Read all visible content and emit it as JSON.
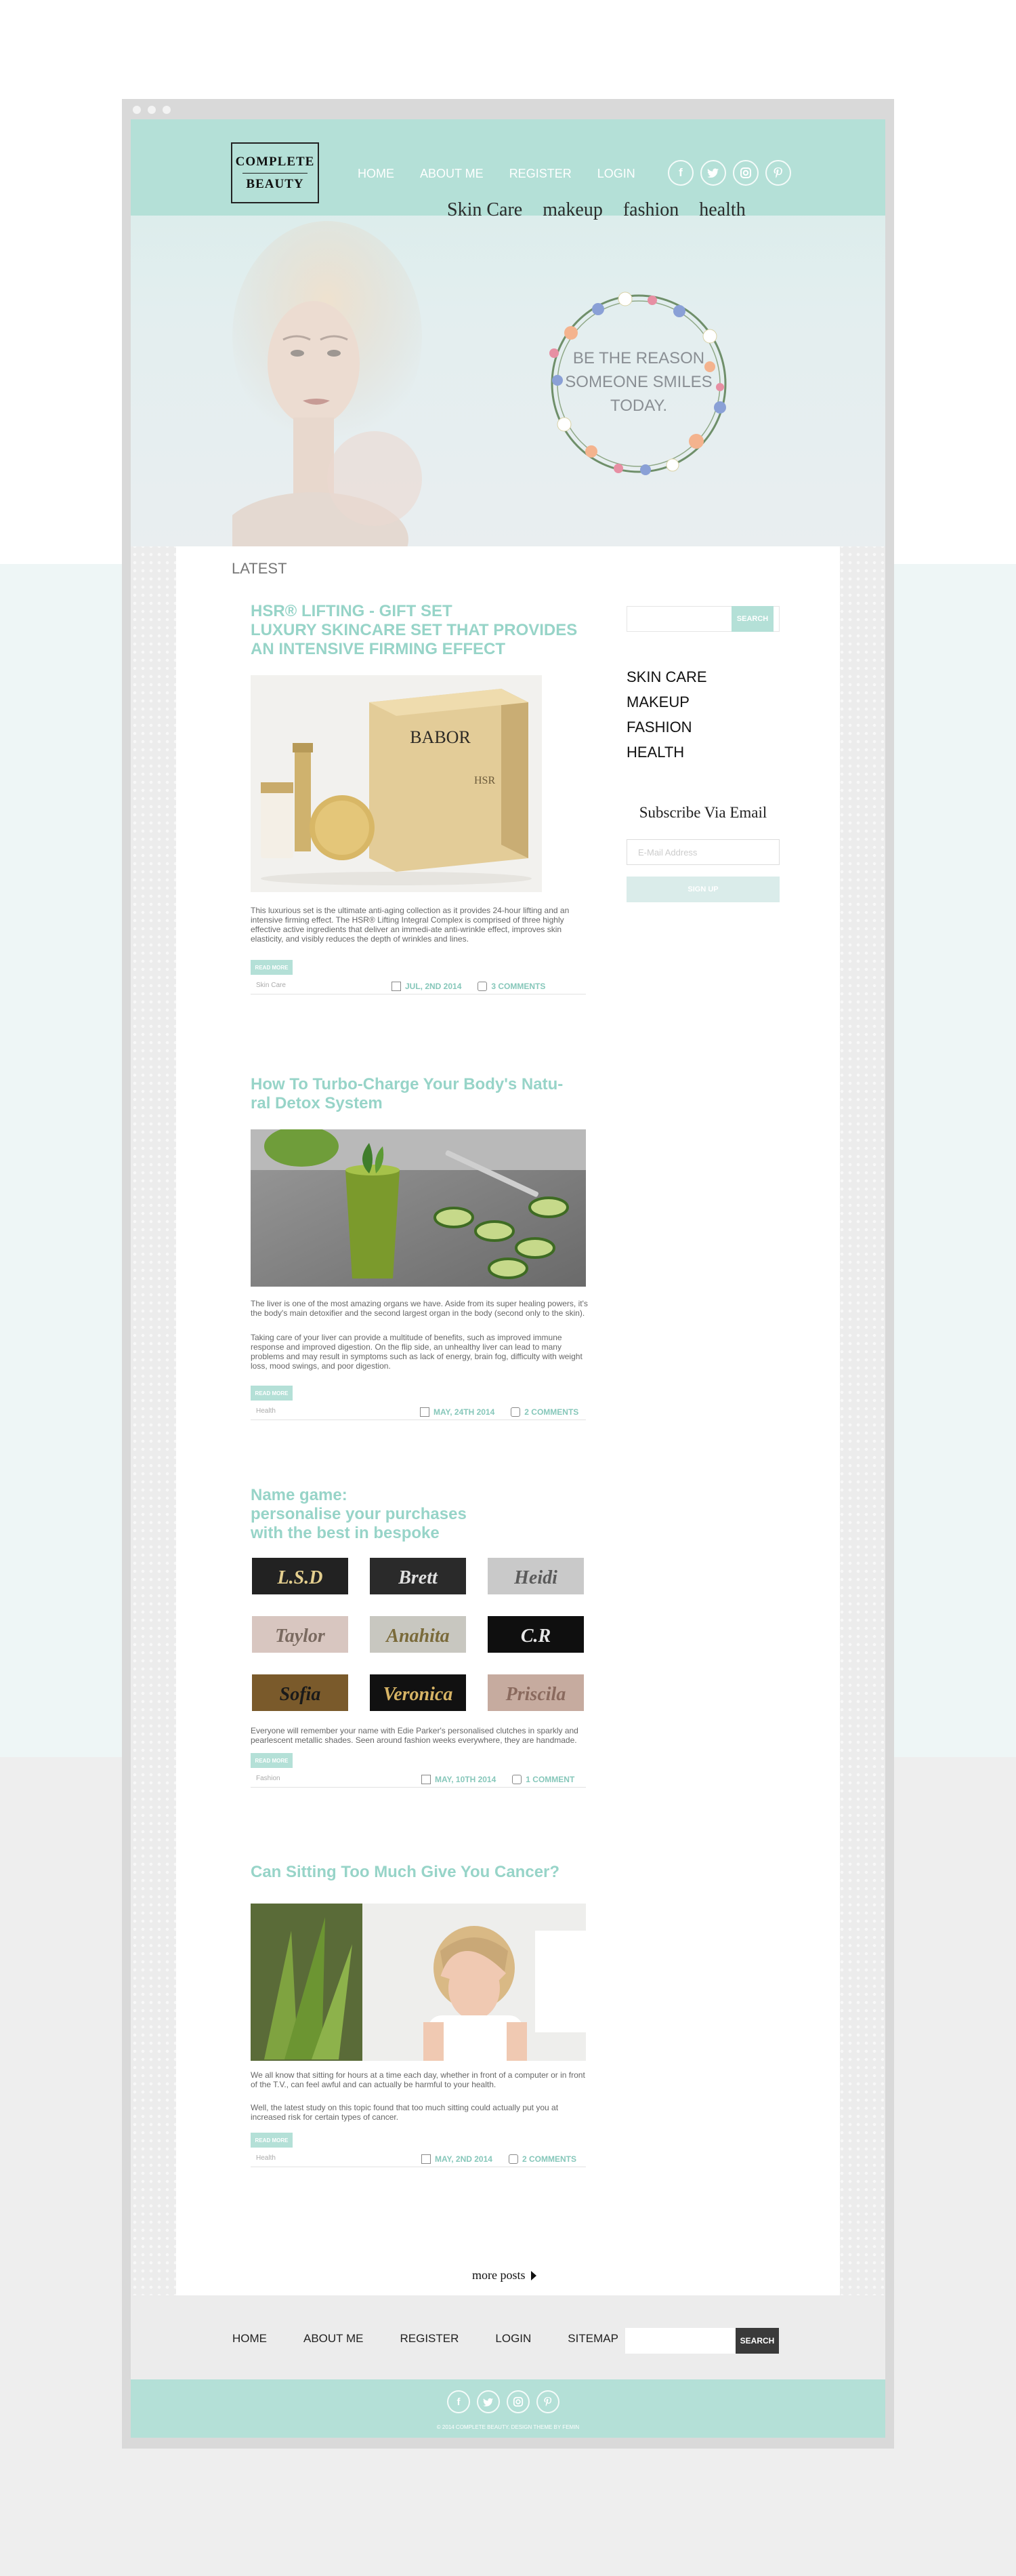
{
  "site": {
    "logo_line1": "COMPLETE",
    "logo_line2": "BEAUTY",
    "nav": [
      "HOME",
      "ABOUT ME",
      "REGISTER",
      "LOGIN"
    ],
    "socials": [
      "facebook-icon",
      "twitter-icon",
      "instagram-icon",
      "pinterest-icon"
    ],
    "categories": [
      "Skin Care",
      "makeup",
      "fashion",
      "health"
    ],
    "hero_quote": [
      "BE THE REASON",
      "SOMEONE SMILES",
      "TODAY."
    ]
  },
  "main": {
    "section_label": "LATEST",
    "more_posts": "more posts"
  },
  "posts": [
    {
      "title_lines": [
        "HSR® LIFTING - GIFT SET",
        "LUXURY SKINCARE SET THAT PROVIDES",
        "AN INTENSIVE FIRMING EFFECT"
      ],
      "image_brand": "BABOR",
      "paragraphs": [
        "This luxurious set is the ultimate anti-aging collection as it provides 24-hour lifting and an intensive firming effect. The HSR® Lifting Integral Complex is comprised of three highly effective active ingredients that deliver an immedi-ate anti-wrinkle effect, improves skin elasticity, and visibly reduces the depth of wrinkles and lines."
      ],
      "read_more": "READ MORE",
      "category": "Skin Care",
      "date": "JUL, 2ND 2014",
      "comments": "3 COMMENTS"
    },
    {
      "title_lines": [
        "How To Turbo-Charge Your Body's Natu-",
        "ral Detox System"
      ],
      "paragraphs": [
        "The liver is one of the most amazing organs we have. Aside from its super healing powers, it's the body's main detoxifier and the second largest organ in the body (second only to the skin).",
        "Taking care of your liver can provide a multitude of benefits, such as improved immune response and improved digestion. On the flip side, an unhealthy liver can lead to many problems and may result in symptoms such as lack of energy, brain fog, difficulty with weight loss, mood swings, and poor digestion."
      ],
      "read_more": "READ MORE",
      "category": "Health",
      "date": "MAY, 24TH 2014",
      "comments": "2 COMMENTS"
    },
    {
      "title_lines": [
        "Name game:",
        "personalise your purchases",
        "with the best in bespoke"
      ],
      "clutches": [
        "L.S.D",
        "Brett",
        "Heidi",
        "Taylor",
        "Anahita",
        "C.R",
        "Sofia",
        "Veronica",
        "Priscila"
      ],
      "paragraphs": [
        "Everyone will remember your name with Edie Parker's personalised clutches in sparkly and pearlescent metallic shades. Seen around fashion weeks everywhere, they are handmade."
      ],
      "read_more": "READ MORE",
      "category": "Fashion",
      "date": "MAY, 10TH 2014",
      "comments": "1 COMMENT"
    },
    {
      "title_lines": [
        "Can Sitting Too Much Give You Cancer?"
      ],
      "paragraphs": [
        "We all know that sitting for hours at a time each day, whether in front of a computer or in front of the T.V., can feel awful and can actually be harmful to your health.",
        "Well, the latest study on this topic found that too much sitting could actually put you at increased risk for certain types of cancer."
      ],
      "read_more": "READ MORE",
      "category": "Health",
      "date": "MAY, 2ND 2014",
      "comments": "2 COMMENTS"
    }
  ],
  "sidebar": {
    "search_button": "SEARCH",
    "categories": [
      "SKIN CARE",
      "MAKEUP",
      "FASHION",
      "HEALTH"
    ],
    "subscribe_title": "Subscribe Via Email",
    "email_placeholder": "E-Mail Address",
    "signup_button": "SIGN UP"
  },
  "footer": {
    "nav": [
      "HOME",
      "ABOUT ME",
      "REGISTER",
      "LOGIN",
      "SITEMAP"
    ],
    "search_button": "SEARCH",
    "copyright": "© 2014 COMPLETE BEAUTY. DESIGN THEME BY FEMIN"
  },
  "colors": {
    "mint": "#b4e0d7",
    "title_mint": "#97d4c8",
    "meta_mint": "#86c7ba",
    "dark_button": "#3a3a3a"
  }
}
